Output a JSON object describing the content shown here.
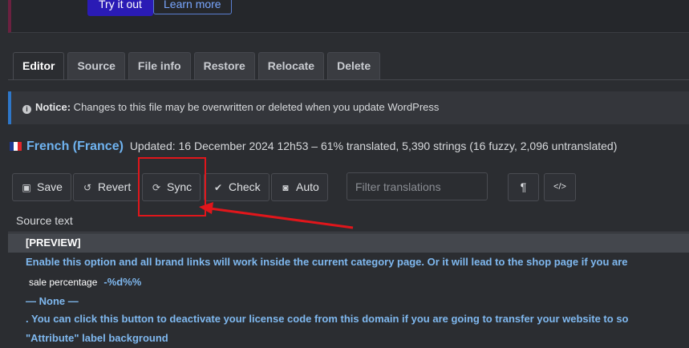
{
  "banner": {
    "try_label": "Try it out",
    "learn_label": "Learn more"
  },
  "tabs": [
    {
      "label": "Editor",
      "active": true
    },
    {
      "label": "Source"
    },
    {
      "label": "File info"
    },
    {
      "label": "Restore"
    },
    {
      "label": "Relocate"
    },
    {
      "label": "Delete"
    }
  ],
  "notice": {
    "strong": "Notice:",
    "text": " Changes to this file may be overwritten or deleted when you update WordPress"
  },
  "locale": {
    "language": "French (France)",
    "status": "Updated: 16 December 2024 12h53 – 61% translated, 5,390 strings (16 fuzzy, 2,096 untranslated)",
    "flag_colors": [
      "#1f3a93",
      "#ffffff",
      "#e4262b"
    ]
  },
  "toolbar": {
    "save": "Save",
    "revert": "Revert",
    "sync": "Sync",
    "check": "Check",
    "auto": "Auto",
    "filter_placeholder": "Filter translations",
    "pilcrow": "¶",
    "code": "</>"
  },
  "source": {
    "header": "Source text",
    "rows": {
      "preview": "[PREVIEW]",
      "r1": "Enable this option and all brand links will work inside the current category page. Or it will lead to the shop page if you are",
      "ctx_label": "sale percentage",
      "ctx_text": "-%d%%",
      "none": "— None —",
      "r2": ". You can click this button to deactivate your license code from this domain if you are going to transfer your website to so",
      "r3": "\"Attribute\" label background"
    }
  },
  "colors": {
    "accent_red": "#e0161b",
    "link_blue": "#7fb8ef",
    "primary_button": "#2a1bb5"
  }
}
